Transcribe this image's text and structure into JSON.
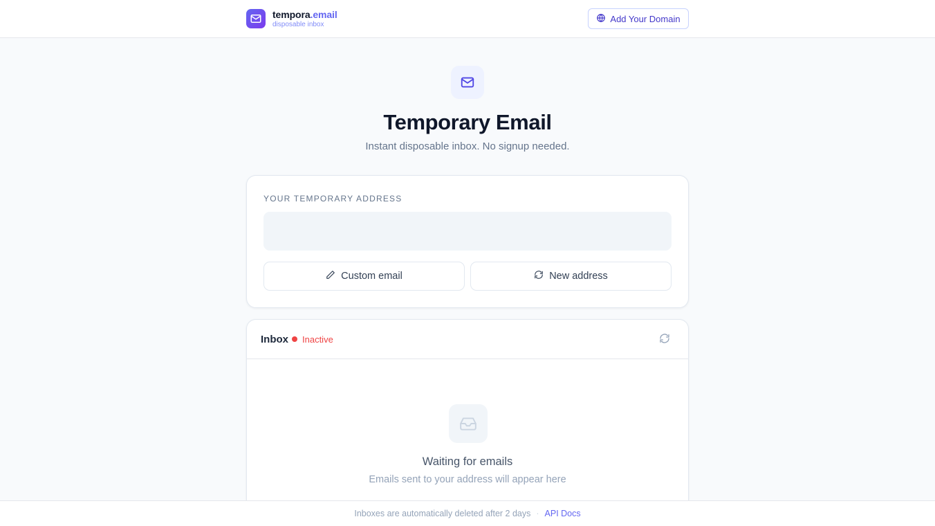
{
  "header": {
    "brand_name": "tempora",
    "brand_accent": ".email",
    "brand_sub": "disposable inbox",
    "domain_button": "Add Your Domain"
  },
  "hero": {
    "title": "Temporary Email",
    "subtitle": "Instant disposable inbox. No signup needed."
  },
  "address_card": {
    "label": "YOUR TEMPORARY ADDRESS",
    "address_value": "",
    "custom_button": "Custom email",
    "new_button": "New address"
  },
  "inbox": {
    "title": "Inbox",
    "status": "Inactive",
    "empty_title": "Waiting for emails",
    "empty_sub": "Emails sent to your address will appear here"
  },
  "footer": {
    "notice": "Inboxes are automatically deleted after 2 days",
    "separator": "·",
    "api_link": "API Docs"
  },
  "colors": {
    "accent": "#6366f1",
    "inactive": "#ef4444",
    "background": "#f8fafc"
  },
  "icons": [
    "mail-icon",
    "globe-icon",
    "pencil-icon",
    "refresh-icon",
    "inbox-icon"
  ]
}
